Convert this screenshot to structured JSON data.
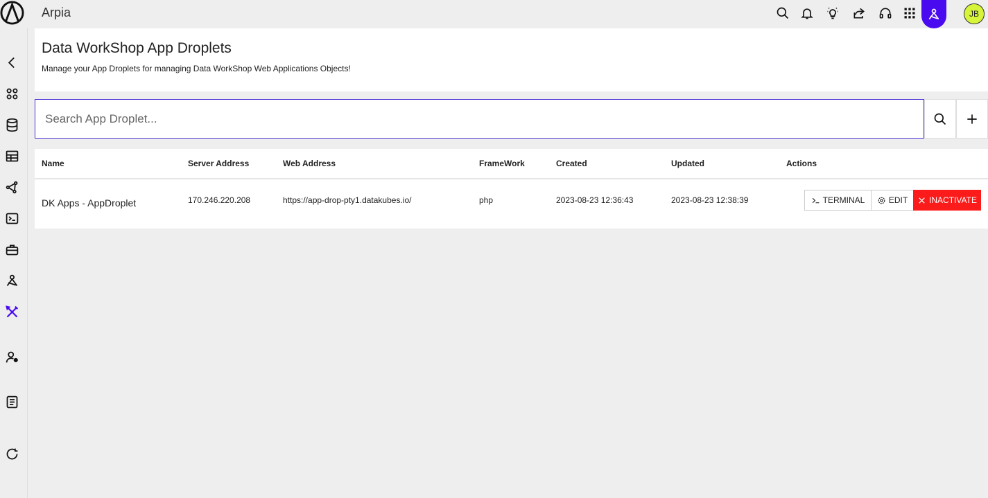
{
  "app": {
    "title": "Arpia",
    "avatar_initials": "JB",
    "accent_color": "#4a0af0",
    "avatar_color": "#d6f53a"
  },
  "topbar_icons": [
    "search-icon",
    "bell-icon",
    "lightbulb-icon",
    "share-icon",
    "headset-icon",
    "apps-grid-icon",
    "agent-icon"
  ],
  "sidebar_icons": [
    "back-arrow-icon",
    "apps-icon",
    "database-icon",
    "table-icon",
    "graph-nodes-icon",
    "terminal-icon",
    "toolbox-icon",
    "agent-icon",
    "tools-icon",
    "user-settings-icon",
    "book-icon",
    "refresh-icon"
  ],
  "page": {
    "title": "Data WorkShop App Droplets",
    "subtitle": "Manage your App Droplets for managing Data WorkShop Web Applications Objects!"
  },
  "search": {
    "placeholder": "Search App Droplet..."
  },
  "table": {
    "columns": [
      "Name",
      "Server Address",
      "Web Address",
      "FrameWork",
      "Created",
      "Updated",
      "Actions"
    ],
    "rows": [
      {
        "name": "DK Apps - AppDroplet",
        "server_address": "170.246.220.208",
        "web_address": "https://app-drop-pty1.datakubes.io/",
        "framework": "php",
        "created": "2023-08-23 12:36:43",
        "updated": "2023-08-23 12:38:39",
        "actions": {
          "terminal": "TERMINAL",
          "edit": "EDIT",
          "inactivate": "INACTIVATE"
        }
      }
    ]
  },
  "colors": {
    "danger": "#fb1b1b",
    "active_sidebar": "#4a0af0"
  }
}
